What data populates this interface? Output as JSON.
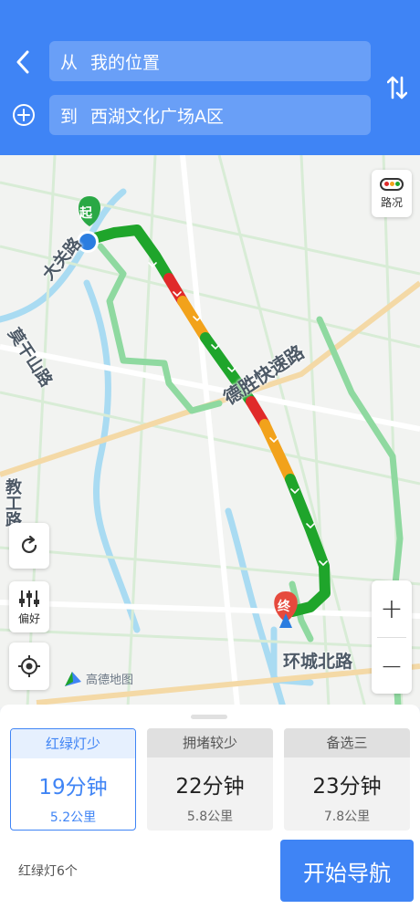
{
  "header": {
    "from_prefix": "从",
    "from_value": "我的位置",
    "to_prefix": "到",
    "to_value": "西湖文化广场A区"
  },
  "map": {
    "road_labels": {
      "dasheng": "大关路",
      "moganshan": "莫干山路",
      "desheng": "德胜快速路",
      "jiaogong": "教工路",
      "huancheng": "环城北路"
    },
    "start_marker": "起",
    "end_marker": "终",
    "traffic_label": "路况",
    "preference_label": "偏好",
    "logo_text": "高德地图",
    "zoom_in": "+",
    "zoom_out": "−",
    "colors": {
      "route_smooth": "#1fa52b",
      "route_slow": "#f2a21b",
      "route_jam": "#e02a2a",
      "alt_route": "#8fd9a0",
      "accent": "#3f84f5"
    }
  },
  "routes": [
    {
      "tag": "红绿灯少",
      "time": "19分钟",
      "distance": "5.2公里",
      "selected": true
    },
    {
      "tag": "拥堵较少",
      "time": "22分钟",
      "distance": "5.8公里",
      "selected": false
    },
    {
      "tag": "备选三",
      "time": "23分钟",
      "distance": "7.8公里",
      "selected": false
    }
  ],
  "footer": {
    "traffic_lights": "红绿灯6个",
    "start_label": "开始导航"
  }
}
